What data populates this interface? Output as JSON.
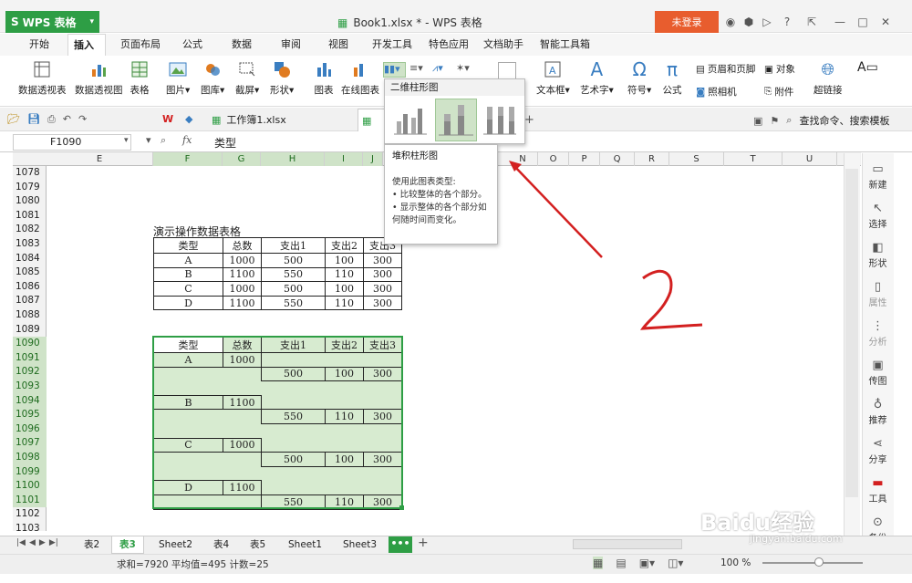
{
  "app": {
    "name": "WPS 表格",
    "doc_title": "Book1.xlsx * - WPS 表格",
    "login_label": "未登录"
  },
  "menu": [
    "开始",
    "插入",
    "页面布局",
    "公式",
    "数据",
    "审阅",
    "视图",
    "开发工具",
    "特色应用",
    "文档助手",
    "智能工具箱"
  ],
  "active_menu": "插入",
  "ribbon": {
    "pivot_table": "数据透视表",
    "pivot_chart": "数据透视图",
    "table": "表格",
    "picture": "图片",
    "gallery": "图库",
    "screenshot": "截屏",
    "shape": "形状",
    "chart": "图表",
    "online_chart": "在线图表",
    "textbox": "文本框",
    "wordart": "艺术字",
    "symbol": "符号",
    "formula": "公式",
    "header_footer": "页眉和页脚",
    "object": "对象",
    "camera": "照相机",
    "attachment": "附件",
    "hyperlink": "超链接"
  },
  "filetab": {
    "name": "工作簿1.xlsx",
    "search": "查找命令、搜索模板"
  },
  "namebox": "F1090",
  "fx": "fx",
  "formula_value": "类型",
  "columns": [
    "E",
    "F",
    "G",
    "H",
    "I",
    "J",
    "N",
    "O",
    "P",
    "Q",
    "R",
    "S",
    "T",
    "U"
  ],
  "rows": [
    "1078",
    "1079",
    "1080",
    "1081",
    "1082",
    "1083",
    "1084",
    "1085",
    "1086",
    "1087",
    "1088",
    "1089",
    "1090",
    "1091",
    "1092",
    "1093",
    "1094",
    "1095",
    "1096",
    "1097",
    "1098",
    "1099",
    "1100",
    "1101",
    "1102",
    "1103"
  ],
  "table1": {
    "caption": "演示操作数据表格",
    "header": [
      "类型",
      "总数",
      "支出1",
      "支出2",
      "支出3"
    ],
    "rows": [
      [
        "A",
        "1000",
        "500",
        "100",
        "300"
      ],
      [
        "B",
        "1100",
        "550",
        "110",
        "300"
      ],
      [
        "C",
        "1000",
        "500",
        "100",
        "300"
      ],
      [
        "D",
        "1100",
        "550",
        "110",
        "300"
      ]
    ]
  },
  "table2": {
    "header": [
      "类型",
      "总数",
      "支出1",
      "支出2",
      "支出3"
    ],
    "groups": [
      {
        "type": "A",
        "total": "1000",
        "e1": "500",
        "e2": "100",
        "e3": "300"
      },
      {
        "type": "B",
        "total": "1100",
        "e1": "550",
        "e2": "110",
        "e3": "300"
      },
      {
        "type": "C",
        "total": "1000",
        "e1": "500",
        "e2": "100",
        "e3": "300"
      },
      {
        "type": "D",
        "total": "1100",
        "e1": "550",
        "e2": "110",
        "e3": "300"
      }
    ]
  },
  "dropdown": {
    "title": "二维柱形图"
  },
  "tooltip": {
    "title": "堆积柱形图",
    "line1": "使用此图表类型:",
    "line2": "• 比较整体的各个部分。",
    "line3": "• 显示整体的各个部分如何随时间而变化。"
  },
  "annotation": "2",
  "right_panel": [
    "新建",
    "选择",
    "形状",
    "属性",
    "分析",
    "传图",
    "推荐",
    "分享",
    "工具",
    "备份"
  ],
  "sheets": [
    "表2",
    "表3",
    "Sheet2",
    "表4",
    "表5",
    "Sheet1",
    "Sheet3"
  ],
  "active_sheet": "表3",
  "status": "求和=7920  平均值=495  计数=25",
  "zoom": "100 %",
  "watermark": "Baidu经验",
  "watermark_url": "jingyan.baidu.com",
  "colors": {
    "accent": "#2e9e45",
    "login": "#e85d2e",
    "annotation": "#d32020"
  }
}
